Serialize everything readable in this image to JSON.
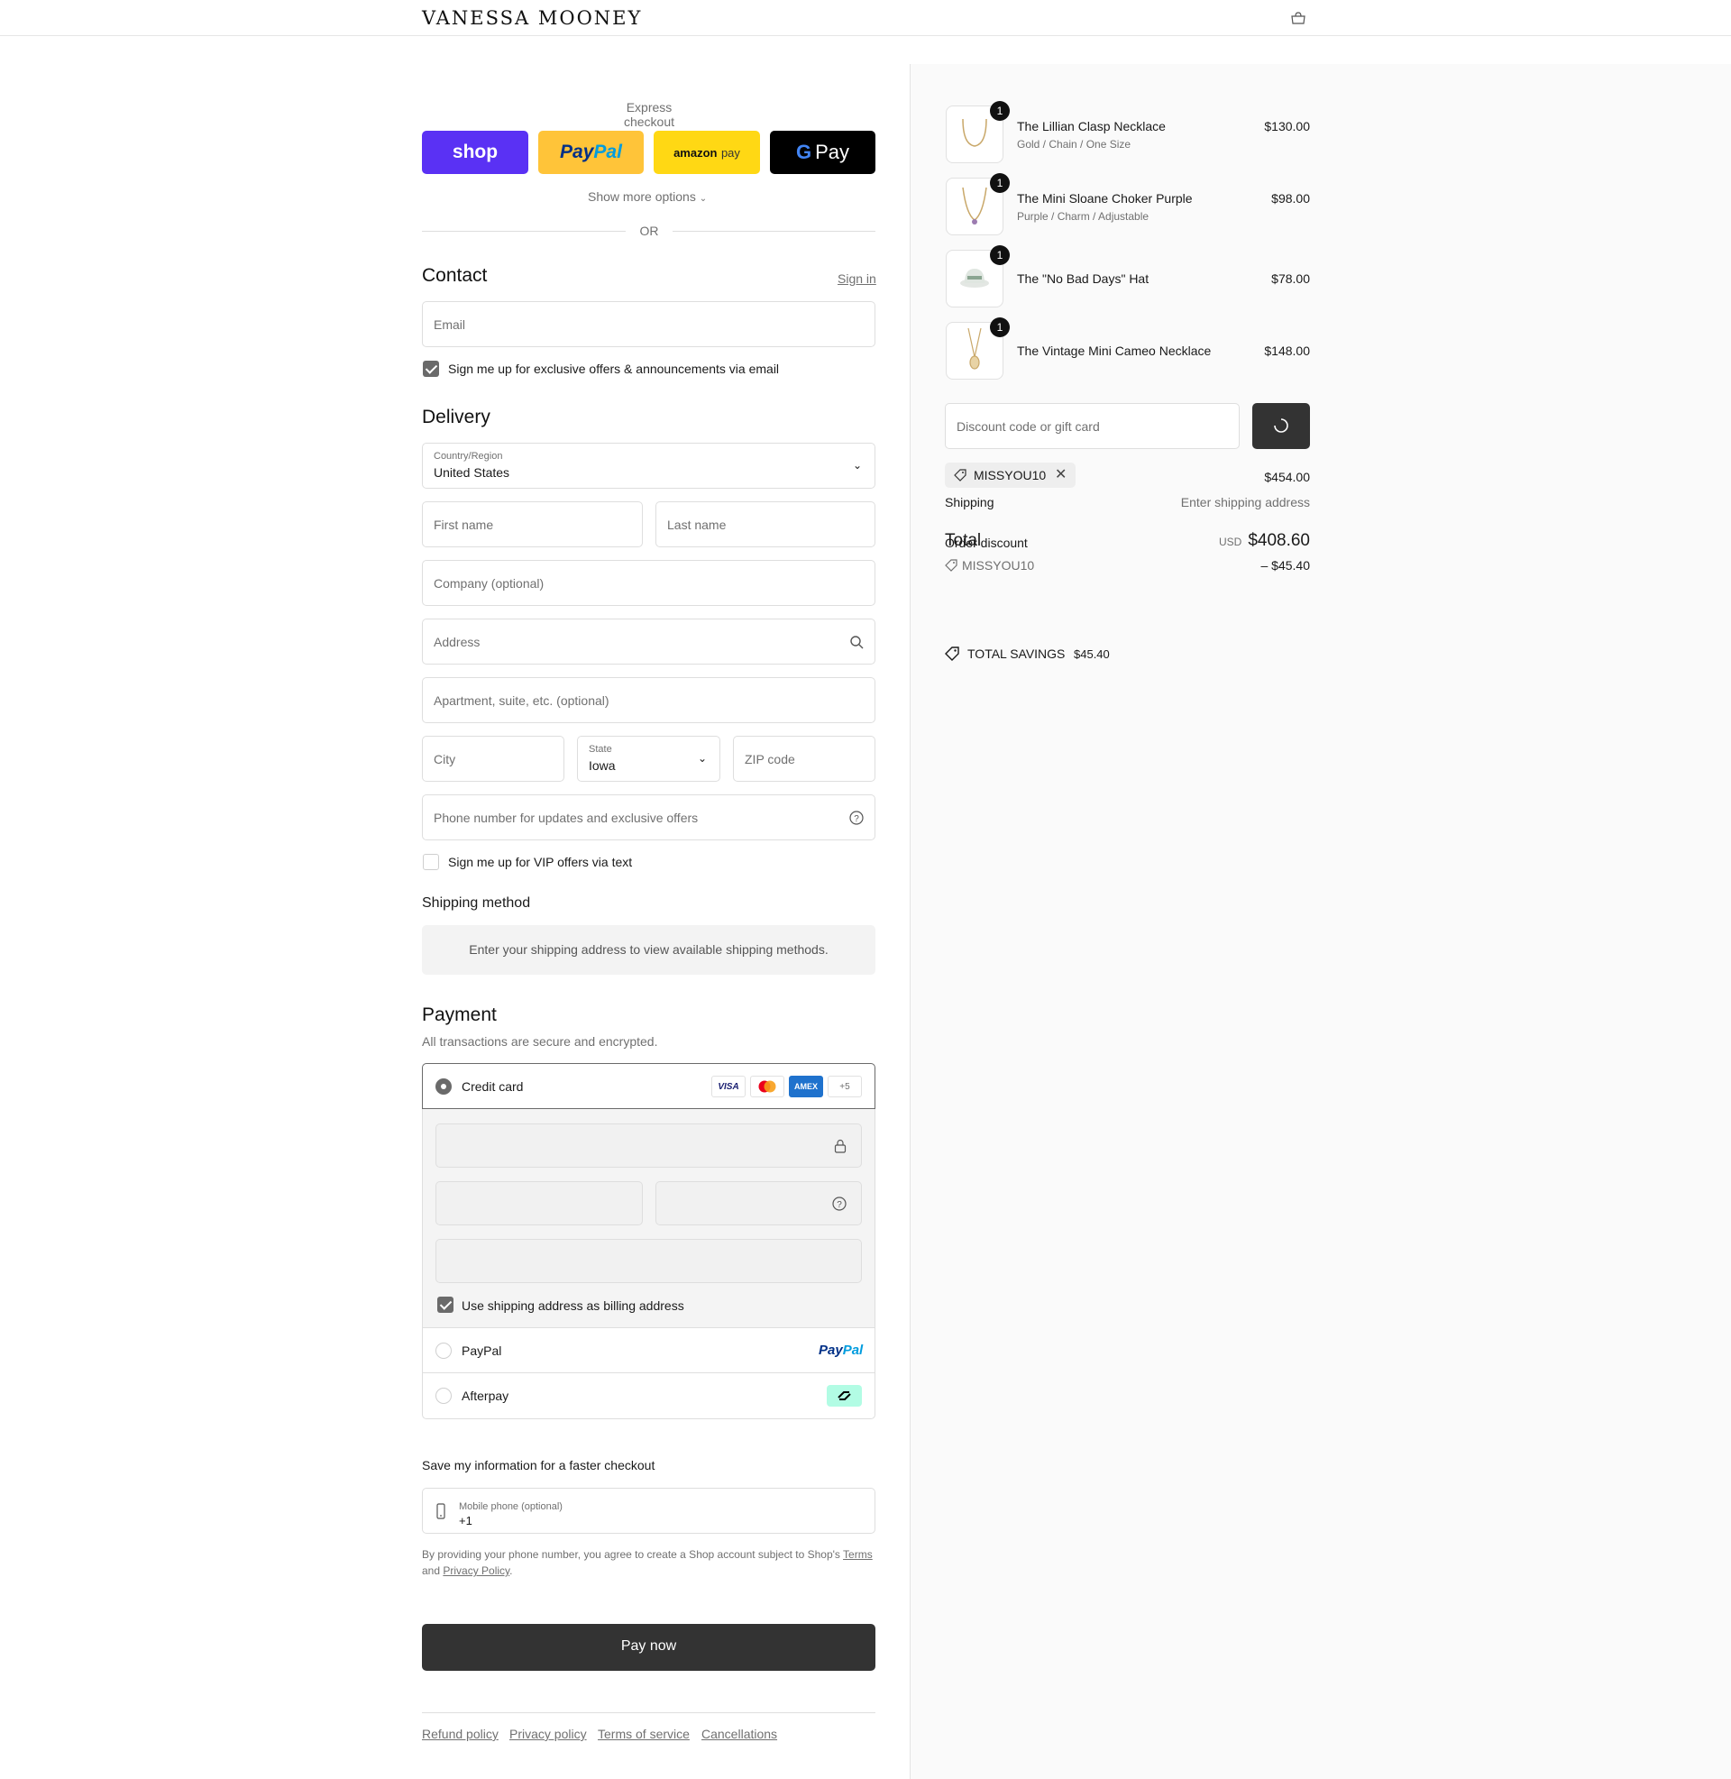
{
  "header": {
    "logo": "VANESSA MOONEY",
    "cart_icon": "bag-icon"
  },
  "express": {
    "title": "Express checkout",
    "shop_label": "shop",
    "paypal_label_1": "Pay",
    "paypal_label_2": "Pal",
    "amazon_label_1": "amazon",
    "amazon_label_2": "pay",
    "gpay_label": "Pay",
    "show_more": "Show more options",
    "or": "OR",
    "colors": {
      "shop": "#5a31f4",
      "paypal": "#ffc439",
      "amazon": "#ffd814",
      "gpay": "#000000"
    }
  },
  "contact": {
    "title": "Contact",
    "sign_in": "Sign in",
    "email_placeholder": "Email",
    "newsletter_label": "Sign me up for exclusive offers & announcements via email",
    "newsletter_checked": true
  },
  "delivery": {
    "title": "Delivery",
    "country_label": "Country/Region",
    "country_value": "United States",
    "first_name": "First name",
    "last_name": "Last name",
    "company": "Company (optional)",
    "address": "Address",
    "apartment": "Apartment, suite, etc. (optional)",
    "city": "City",
    "state_label": "State",
    "state_value": "Iowa",
    "zip": "ZIP code",
    "phone": "Phone number for updates and exclusive offers",
    "vip_label": "Sign me up for VIP offers via text",
    "vip_checked": false
  },
  "shipping_method": {
    "title": "Shipping method",
    "notice": "Enter your shipping address to view available shipping methods."
  },
  "payment": {
    "title": "Payment",
    "subtitle": "All transactions are secure and encrypted.",
    "credit_card": "Credit card",
    "card_logos": {
      "visa": "VISA",
      "amex": "AMEX",
      "more": "+5"
    },
    "billing_label": "Use shipping address as billing address",
    "billing_checked": true,
    "paypal": "PayPal",
    "paypal_logo_1": "Pay",
    "paypal_logo_2": "Pal",
    "afterpay": "Afterpay"
  },
  "save_info": {
    "title": "Save my information for a faster checkout",
    "mobile_label": "Mobile phone (optional)",
    "mobile_value": "+1",
    "legal_1": "By providing your phone number, you agree to create a Shop account subject to Shop's",
    "terms": "Terms",
    "legal_and": "and",
    "privacy": "Privacy Policy",
    "legal_end": "."
  },
  "pay_now": "Pay now",
  "footer": {
    "refund": "Refund policy",
    "privacy": "Privacy policy",
    "terms": "Terms of service",
    "cancellations": "Cancellations"
  },
  "summary": {
    "items": [
      {
        "qty": "1",
        "name": "The Lillian Clasp Necklace",
        "variant": "Gold / Chain / One Size",
        "price": "$130.00"
      },
      {
        "qty": "1",
        "name": "The Mini Sloane Choker Purple",
        "variant": "Purple / Charm / Adjustable",
        "price": "$98.00"
      },
      {
        "qty": "1",
        "name": "The \"No Bad Days\" Hat",
        "variant": "",
        "price": "$78.00"
      },
      {
        "qty": "1",
        "name": "The Vintage Mini Cameo Necklace",
        "variant": "",
        "price": "$148.00"
      }
    ],
    "discount_placeholder": "Discount code or gift card",
    "code_tag": "MISSYOU10",
    "subtotal_value": "$454.00",
    "shipping_label": "Shipping",
    "shipping_value": "Enter shipping address",
    "total_label": "Total",
    "order_discount_label": "Order discount",
    "currency": "USD",
    "total_value": "$408.60",
    "discount_code": "MISSYOU10",
    "discount_value": "– $45.40",
    "savings_label": "TOTAL SAVINGS",
    "savings_value": "$45.40"
  }
}
